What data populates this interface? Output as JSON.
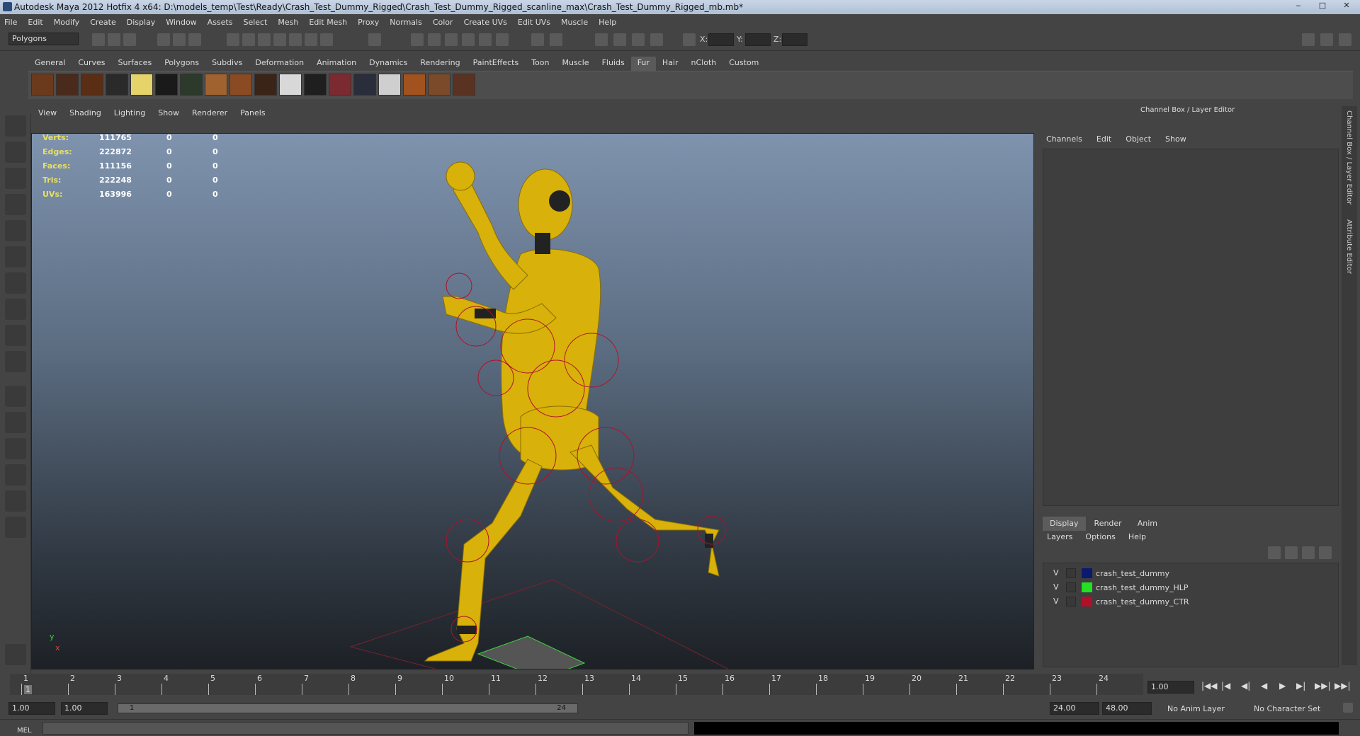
{
  "window": {
    "title": "Autodesk Maya 2012 Hotfix 4 x64: D:\\models_temp\\Test\\Ready\\Crash_Test_Dummy_Rigged\\Crash_Test_Dummy_Rigged_scanline_max\\Crash_Test_Dummy_Rigged_mb.mb*",
    "minimize": "‒",
    "maximize": "□",
    "close": "✕"
  },
  "menubar": [
    "File",
    "Edit",
    "Modify",
    "Create",
    "Display",
    "Window",
    "Assets",
    "Select",
    "Mesh",
    "Edit Mesh",
    "Proxy",
    "Normals",
    "Color",
    "Create UVs",
    "Edit UVs",
    "Muscle",
    "Help"
  ],
  "statusline": {
    "mode": "Polygons",
    "x_label": "X:",
    "y_label": "Y:",
    "z_label": "Z:"
  },
  "shelf": {
    "tabs": [
      "General",
      "Curves",
      "Surfaces",
      "Polygons",
      "Subdivs",
      "Deformation",
      "Animation",
      "Dynamics",
      "Rendering",
      "PaintEffects",
      "Toon",
      "Muscle",
      "Fluids",
      "Fur",
      "Hair",
      "nCloth",
      "Custom"
    ],
    "active_tab": "Fur",
    "swatch_colors": [
      "#6b3a1c",
      "#4a2a1a",
      "#5a2e14",
      "#2a2a2a",
      "#e6d36a",
      "#1a1a1a",
      "#2b3a2b",
      "#a0622e",
      "#8a4a22",
      "#3a2418",
      "#d8d8d8",
      "#1f1f1f",
      "#7a2a30",
      "#2a2e3a",
      "#cfcfcf",
      "#a2521e",
      "#7a4a2a",
      "#5a3222"
    ]
  },
  "viewport": {
    "menu": [
      "View",
      "Shading",
      "Lighting",
      "Show",
      "Renderer",
      "Panels"
    ],
    "hud": [
      {
        "label": "Verts:",
        "v1": "111765",
        "v2": "0",
        "v3": "0"
      },
      {
        "label": "Edges:",
        "v1": "222872",
        "v2": "0",
        "v3": "0"
      },
      {
        "label": "Faces:",
        "v1": "111156",
        "v2": "0",
        "v3": "0"
      },
      {
        "label": "Tris:",
        "v1": "222248",
        "v2": "0",
        "v3": "0"
      },
      {
        "label": "UVs:",
        "v1": "163996",
        "v2": "0",
        "v3": "0"
      }
    ],
    "axis_y": "y",
    "axis_x": "x",
    "model_color": "#d8b10a"
  },
  "channel_box": {
    "title": "Channel Box / Layer Editor",
    "menu": [
      "Channels",
      "Edit",
      "Object",
      "Show"
    ]
  },
  "layer_editor": {
    "tabs": [
      "Display",
      "Render",
      "Anim"
    ],
    "menu": [
      "Layers",
      "Options",
      "Help"
    ],
    "layers": [
      {
        "visible": "V",
        "name": "crash_test_dummy",
        "color": "#0a1a6e"
      },
      {
        "visible": "V",
        "name": "crash_test_dummy_HLP",
        "color": "#22e022"
      },
      {
        "visible": "V",
        "name": "crash_test_dummy_CTR",
        "color": "#b0102a"
      }
    ]
  },
  "side_tabs": [
    "Channel Box / Layer Editor",
    "Attribute Editor"
  ],
  "timeline": {
    "frames": [
      "1",
      "2",
      "3",
      "4",
      "5",
      "6",
      "7",
      "8",
      "9",
      "10",
      "11",
      "12",
      "13",
      "14",
      "15",
      "16",
      "17",
      "18",
      "19",
      "20",
      "21",
      "22",
      "23",
      "24"
    ],
    "current_frame_marker": "1",
    "current_time": "1.00",
    "playback_buttons": [
      "|◀◀",
      "|◀",
      "◀|",
      "◀",
      "▶",
      "▶|",
      "▶▶|",
      "▶▶|"
    ]
  },
  "range": {
    "start_time": "1.00",
    "playback_start": "1.00",
    "slider_start": "1",
    "slider_end": "24",
    "playback_end": "24.00",
    "end_time": "48.00",
    "anim_layer": "No Anim Layer",
    "character_set": "No Character Set"
  },
  "command_line": {
    "label": "MEL"
  }
}
